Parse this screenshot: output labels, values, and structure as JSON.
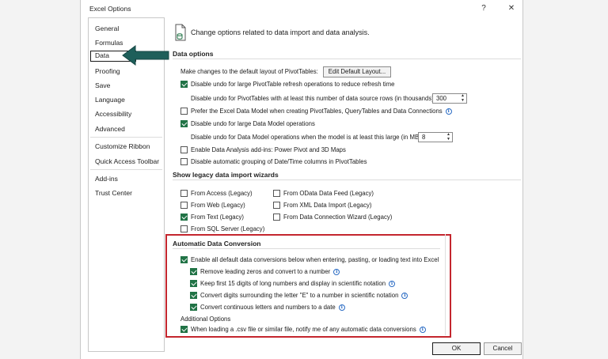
{
  "window": {
    "title": "Excel Options",
    "help_label": "?",
    "close_label": "✕"
  },
  "nav": {
    "items": [
      "General",
      "Formulas",
      "Data",
      "Proofing",
      "Save",
      "Language",
      "Accessibility",
      "Advanced",
      "Customize Ribbon",
      "Quick Access Toolbar",
      "Add-ins",
      "Trust Center"
    ],
    "selected": "Data"
  },
  "header": {
    "text": "Change options related to data import and data analysis.",
    "icon": "data-options-icon"
  },
  "data_options": {
    "title": "Data options",
    "pivot_layout_label": "Make changes to the default layout of PivotTables:",
    "edit_layout_button": "Edit Default Layout...",
    "disable_undo_pivot": "Disable undo for large PivotTable refresh operations to reduce refresh time",
    "disable_undo_rows_label": "Disable undo for PivotTables with at least this number of data source rows (in thousands):",
    "disable_undo_rows_value": "300",
    "prefer_data_model": "Prefer the Excel Data Model when creating PivotTables, QueryTables and Data Connections",
    "disable_undo_model": "Disable undo for large Data Model operations",
    "disable_undo_model_size_label": "Disable undo for Data Model operations when the model is at least this large (in MB):",
    "disable_undo_model_size_value": "8",
    "enable_addins": "Enable Data Analysis add-ins: Power Pivot and 3D Maps",
    "disable_grouping": "Disable automatic grouping of Date/Time columns in PivotTables"
  },
  "legacy": {
    "title": "Show legacy data import wizards",
    "from_access": "From Access (Legacy)",
    "from_web": "From Web (Legacy)",
    "from_text": "From Text (Legacy)",
    "from_sql": "From SQL Server (Legacy)",
    "from_odata": "From OData Data Feed (Legacy)",
    "from_xml": "From XML Data Import (Legacy)",
    "from_wizard": "From Data Connection Wizard (Legacy)"
  },
  "auto_conversion": {
    "title": "Automatic Data Conversion",
    "enable_all": "Enable all default data conversions below when entering, pasting, or loading text into Excel",
    "remove_zeros": "Remove leading zeros and convert to a number",
    "keep_digits": "Keep first 15 digits of long numbers and display in scientific notation",
    "convert_e": "Convert digits surrounding the letter \"E\" to a number in scientific notation",
    "convert_dates": "Convert continuous letters and numbers to a date",
    "additional_title": "Additional Options",
    "notify_csv": "When loading a .csv file or similar file, notify me of any automatic data conversions"
  },
  "footer": {
    "ok": "OK",
    "cancel": "Cancel"
  },
  "colors": {
    "check_green": "#217346",
    "highlight_red": "#c4262e",
    "arrow_teal": "#1e5f5a",
    "info_blue": "#2b6cc4"
  }
}
